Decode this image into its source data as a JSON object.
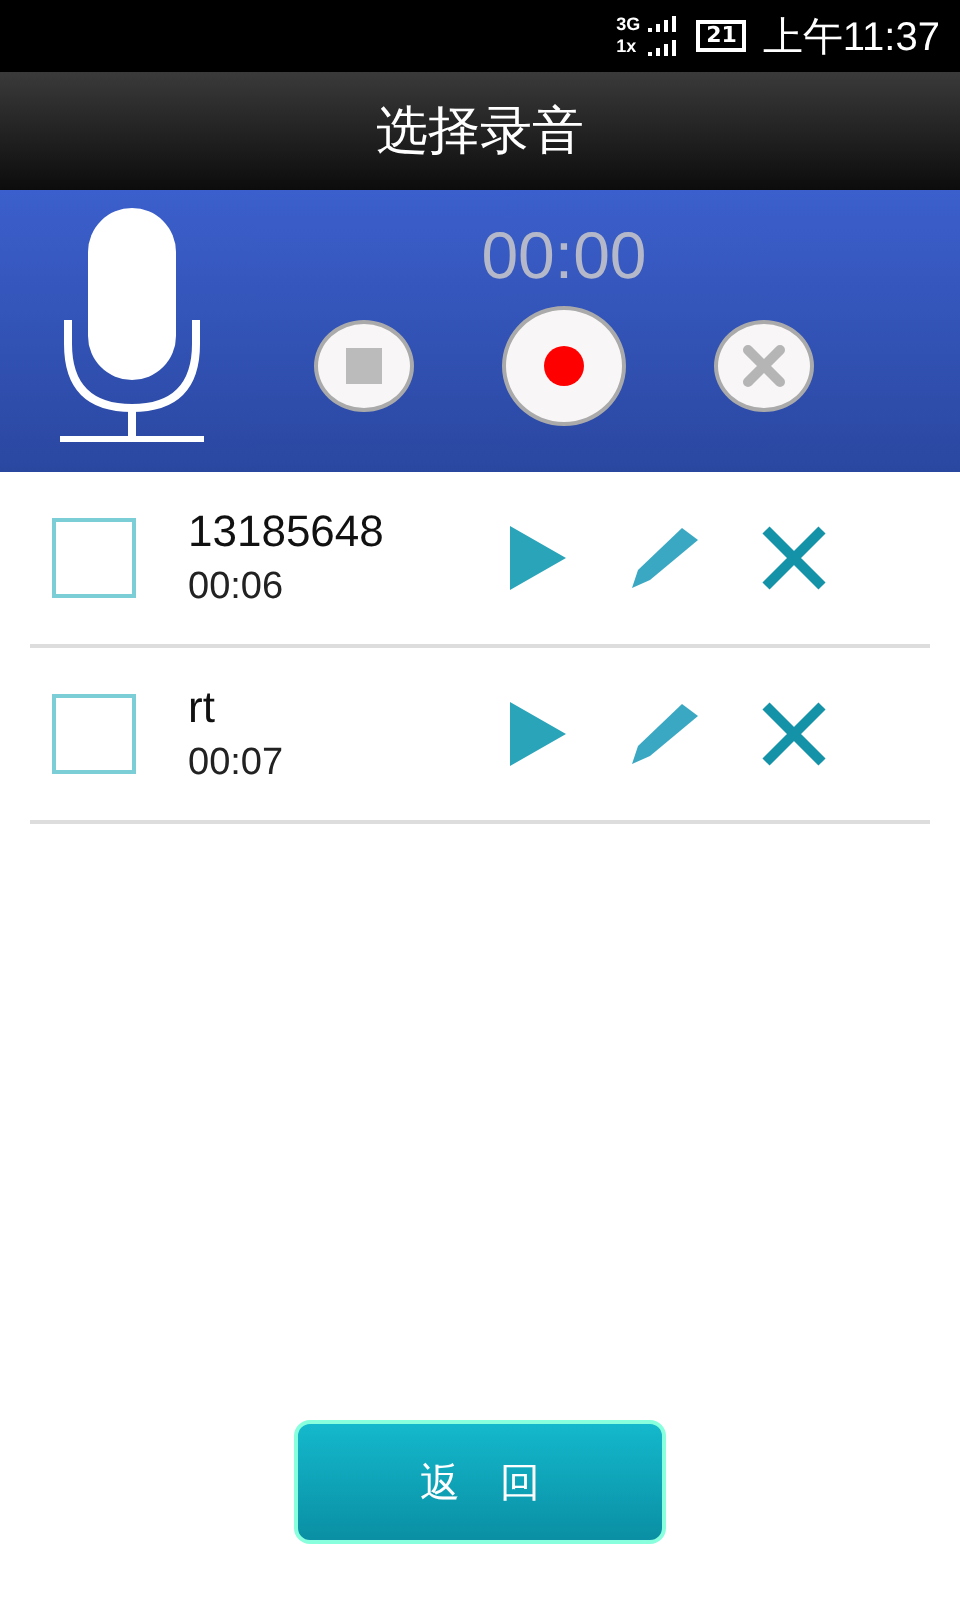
{
  "status_bar": {
    "network_top": "3G",
    "network_bottom": "1x",
    "battery": "21",
    "time": "上午11:37"
  },
  "title": "选择录音",
  "recorder": {
    "timer": "00:00"
  },
  "recordings": [
    {
      "name": "13185648",
      "duration": "00:06",
      "checked": false
    },
    {
      "name": "rt",
      "duration": "00:07",
      "checked": false
    }
  ],
  "back_button": "返　回"
}
